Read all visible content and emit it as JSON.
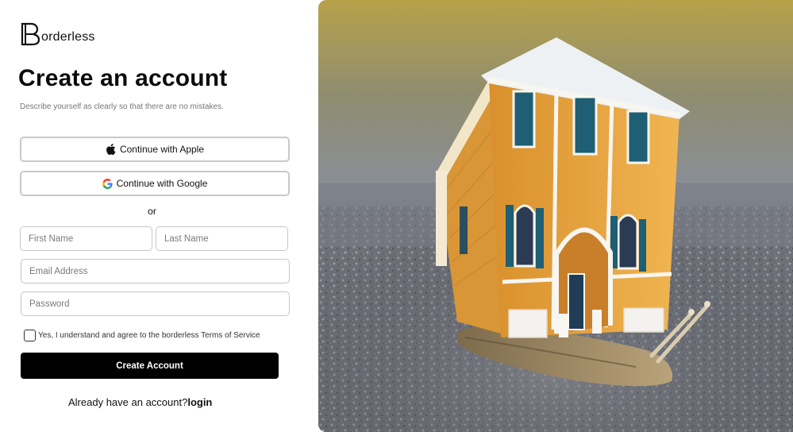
{
  "brand": {
    "logo_letter": "B",
    "name": "orderless"
  },
  "header": {
    "title": "Create an account",
    "subtitle": "Describe yourself as clearly so that there are no mistakes."
  },
  "social": {
    "apple_label": "Continue with Apple",
    "google_label": "Continue with Google",
    "apple_icon": "apple-icon",
    "google_icon": "google-icon"
  },
  "divider": "or",
  "form": {
    "first_name_placeholder": "First Name",
    "last_name_placeholder": "Last Name",
    "email_placeholder": "Email Address",
    "password_placeholder": "Password",
    "terms_label": "Yes, I understand and agree to the borderless Terms of Service",
    "terms_checked": false,
    "submit_label": "Create Account"
  },
  "footer": {
    "prompt": "Already have an account?",
    "login_label": "login"
  },
  "colors": {
    "primary": "#000000",
    "border": "#c9c9c9",
    "house_yellow": "#e9a73f",
    "shutter_teal": "#1e5f73"
  }
}
